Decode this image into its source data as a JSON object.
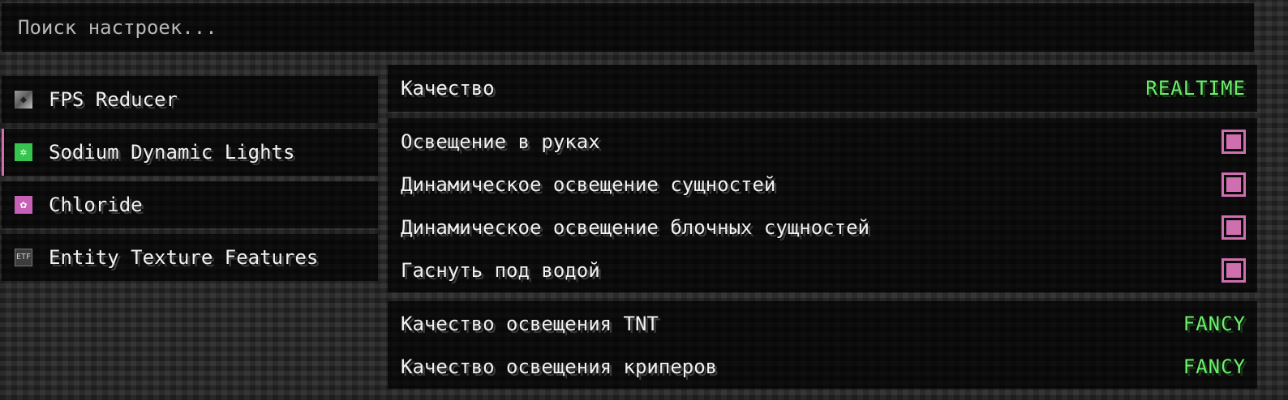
{
  "search": {
    "placeholder": "Поиск настроек..."
  },
  "sidebar": {
    "items": [
      {
        "label": "FPS Reducer",
        "icon": "fps-reducer-icon",
        "glyph": "◆",
        "active": false
      },
      {
        "label": "Sodium Dynamic Lights",
        "icon": "lightbulb-icon",
        "glyph": "✲",
        "active": true
      },
      {
        "label": "Chloride",
        "icon": "chloride-icon",
        "glyph": "✿",
        "active": false
      },
      {
        "label": "Entity Texture Features",
        "icon": "etf-icon",
        "glyph": "ETF",
        "active": false
      }
    ]
  },
  "settings": {
    "quality": {
      "label": "Качество",
      "value": "REALTIME"
    },
    "toggles": [
      {
        "label": "Освещение в руках",
        "checked": true
      },
      {
        "label": "Динамическое освещение сущностей",
        "checked": true
      },
      {
        "label": "Динамическое освещение блочных сущностей",
        "checked": true
      },
      {
        "label": "Гаснуть под водой",
        "checked": true
      }
    ],
    "tnt_quality": {
      "label": "Качество освещения TNT",
      "value": "FANCY"
    },
    "creeper_quality": {
      "label": "Качество освещения криперов",
      "value": "FANCY"
    }
  },
  "colors": {
    "accent": "#d06fb0",
    "value_green": "#6bf06b",
    "panel": "#000000"
  }
}
